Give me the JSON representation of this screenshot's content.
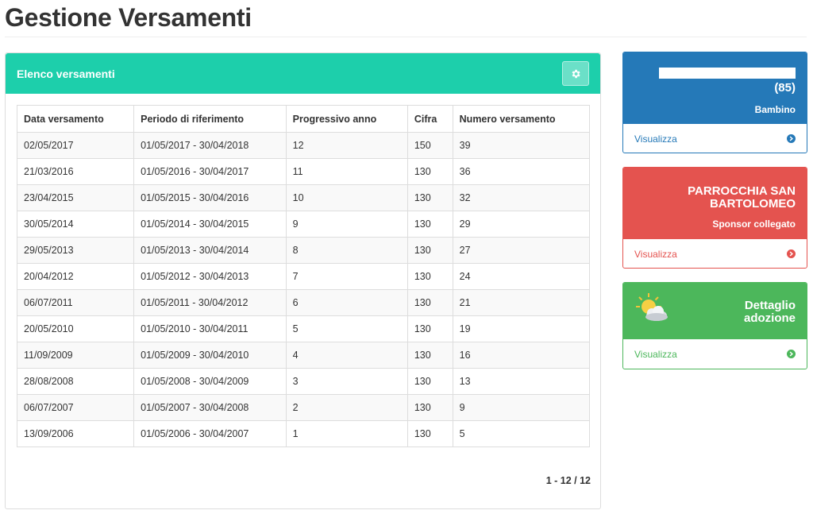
{
  "page": {
    "title": "Gestione Versamenti"
  },
  "panel": {
    "title": "Elenco versamenti",
    "settings_icon": "gear-icon",
    "columns": [
      "Data versamento",
      "Periodo di riferimento",
      "Progressivo anno",
      "Cifra",
      "Numero versamento"
    ],
    "rows": [
      [
        "02/05/2017",
        "01/05/2017 - 30/04/2018",
        "12",
        "150",
        "39"
      ],
      [
        "21/03/2016",
        "01/05/2016 - 30/04/2017",
        "11",
        "130",
        "36"
      ],
      [
        "23/04/2015",
        "01/05/2015 - 30/04/2016",
        "10",
        "130",
        "32"
      ],
      [
        "30/05/2014",
        "01/05/2014 - 30/04/2015",
        "9",
        "130",
        "29"
      ],
      [
        "29/05/2013",
        "01/05/2013 - 30/04/2014",
        "8",
        "130",
        "27"
      ],
      [
        "20/04/2012",
        "01/05/2012 - 30/04/2013",
        "7",
        "130",
        "24"
      ],
      [
        "06/07/2011",
        "01/05/2011 - 30/04/2012",
        "6",
        "130",
        "21"
      ],
      [
        "20/05/2010",
        "01/05/2010 - 30/04/2011",
        "5",
        "130",
        "19"
      ],
      [
        "11/09/2009",
        "01/05/2009 - 30/04/2010",
        "4",
        "130",
        "16"
      ],
      [
        "28/08/2008",
        "01/05/2008 - 30/04/2009",
        "3",
        "130",
        "13"
      ],
      [
        "06/07/2007",
        "01/05/2007 - 30/04/2008",
        "2",
        "130",
        "9"
      ],
      [
        "13/09/2006",
        "01/05/2006 - 30/04/2007",
        "1",
        "130",
        "5"
      ]
    ],
    "pagination": "1 - 12 / 12"
  },
  "cards": {
    "child": {
      "count": "(85)",
      "subtitle": "Bambino",
      "link": "Visualizza",
      "color": "#2579b8",
      "link_icon": "circle-arrow-right-icon"
    },
    "sponsor": {
      "name": "PARROCCHIA SAN BARTOLOMEO",
      "subtitle": "Sponsor collegato",
      "link": "Visualizza",
      "color": "#e4534f",
      "link_icon": "circle-arrow-right-icon"
    },
    "adoption": {
      "title": "Dettaglio adozione",
      "link": "Visualizza",
      "color": "#4cb75b",
      "icon": "weather-sun-cloud-icon",
      "link_icon": "circle-arrow-right-icon"
    }
  },
  "colors": {
    "header_teal": "#1dcfab"
  }
}
